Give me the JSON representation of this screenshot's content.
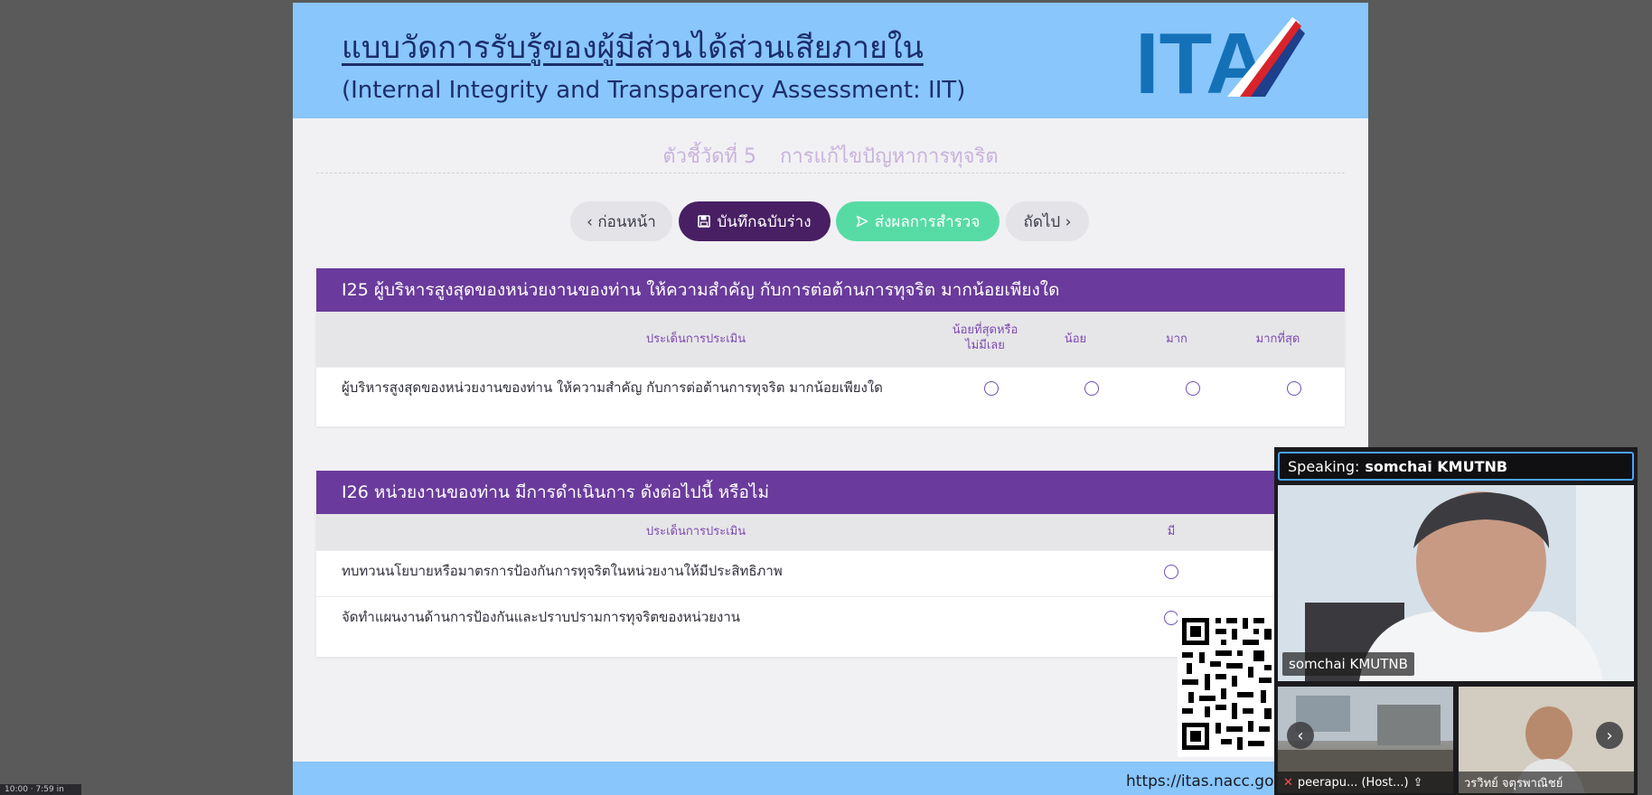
{
  "banner": {
    "title": "แบบวัดการรับรู้ของผู้มีส่วนได้ส่วนเสียภายใน",
    "subtitle": "(Internal Integrity and Transparency Assessment: IIT)",
    "logo_text": "ITA"
  },
  "indicator": {
    "number": "ตัวชี้วัดที่ 5",
    "name": "การแก้ไขปัญหาการทุจริต"
  },
  "nav": {
    "prev_label": "‹ ก่อนหน้า",
    "draft_label": "บันทึกฉบับร่าง",
    "submit_label": "ส่งผลการสำรวจ",
    "next_label": "ถัดไป ›"
  },
  "q25": {
    "title": "I25 ผู้บริหารสูงสุดของหน่วยงานของท่าน ให้ความสำคัญ กับการต่อต้านการทุจริต มากน้อยเพียงใด",
    "col_issue": "ประเด็นการประเมิน",
    "col_opt1_line1": "น้อยที่สุดหรือ",
    "col_opt1_line2": "ไม่มีเลย",
    "col_opt2": "น้อย",
    "col_opt3": "มาก",
    "col_opt4": "มากที่สุด",
    "row1": "ผู้บริหารสูงสุดของหน่วยงานของท่าน ให้ความสำคัญ กับการต่อต้านการทุจริต มากน้อยเพียงใด"
  },
  "q26": {
    "title": "I26 หน่วยงานของท่าน มีการดำเนินการ ดังต่อไปนี้ หรือไม่",
    "col_issue": "ประเด็นการประเมิน",
    "col_yes": "มี",
    "row1": "ทบทวนนโยบายหรือมาตรการป้องกันการทุจริตในหน่วยงานให้มีประสิทธิภาพ",
    "row2": "จัดทำแผนงานด้านการป้องกันและปราบปรามการทุจริตของหน่วยงาน"
  },
  "footer": {
    "url": "https://itas.nacc.go.th/"
  },
  "zoom": {
    "speaking_label": "Speaking:",
    "speaking_name": "somchai KMUTNB",
    "main_name": "somchai KMUTNB",
    "thumb1_name": "peerapu... (Host...)",
    "thumb2_name": "วรวิทย์ จตุรพาณิชย์"
  },
  "clock": {
    "text": "10:00 · 7:59 in"
  },
  "colors": {
    "banner": "#88c6fb",
    "question_header": "#6a3b9c",
    "draft_button": "#481f63",
    "submit_button": "#57dba4",
    "radio_border": "#6f4fb5"
  }
}
